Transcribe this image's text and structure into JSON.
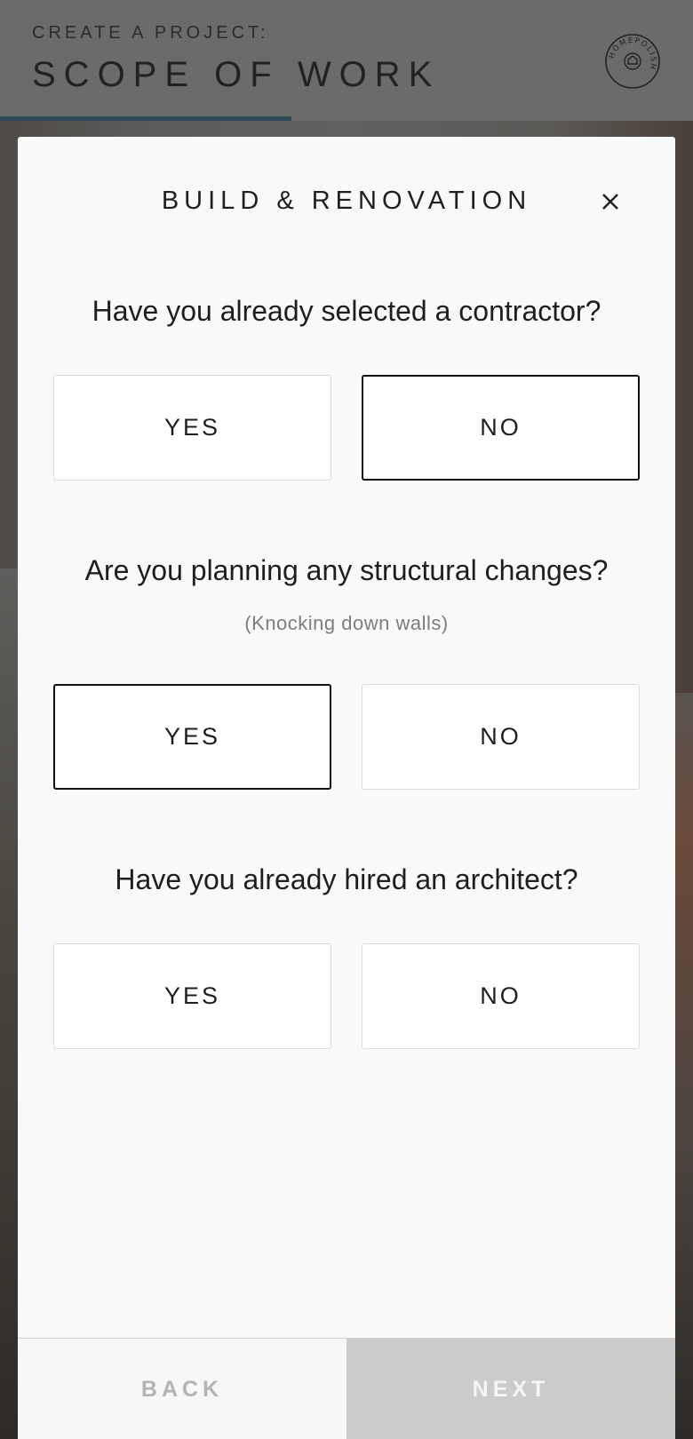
{
  "header": {
    "kicker": "CREATE A PROJECT:",
    "title": "SCOPE OF WORK",
    "logo_text": "HOMEPOLISH",
    "progress_percent": 42
  },
  "modal": {
    "title": "BUILD & RENOVATION",
    "close_icon": "close-icon",
    "questions": [
      {
        "text": "Have you already selected a contractor?",
        "hint": "",
        "yes_label": "YES",
        "no_label": "NO",
        "selected": "NO"
      },
      {
        "text": "Are you planning any structural changes?",
        "hint": "(Knocking down walls)",
        "yes_label": "YES",
        "no_label": "NO",
        "selected": "YES"
      },
      {
        "text": "Have you already hired an architect?",
        "hint": "",
        "yes_label": "YES",
        "no_label": "NO",
        "selected": ""
      }
    ],
    "footer": {
      "back_label": "BACK",
      "next_label": "NEXT"
    }
  },
  "colors": {
    "progress": "#2f4a55",
    "modal_bg": "#f9f9f9",
    "next_bg": "#cbcbcb",
    "header_bg": "#6b6b6b"
  }
}
